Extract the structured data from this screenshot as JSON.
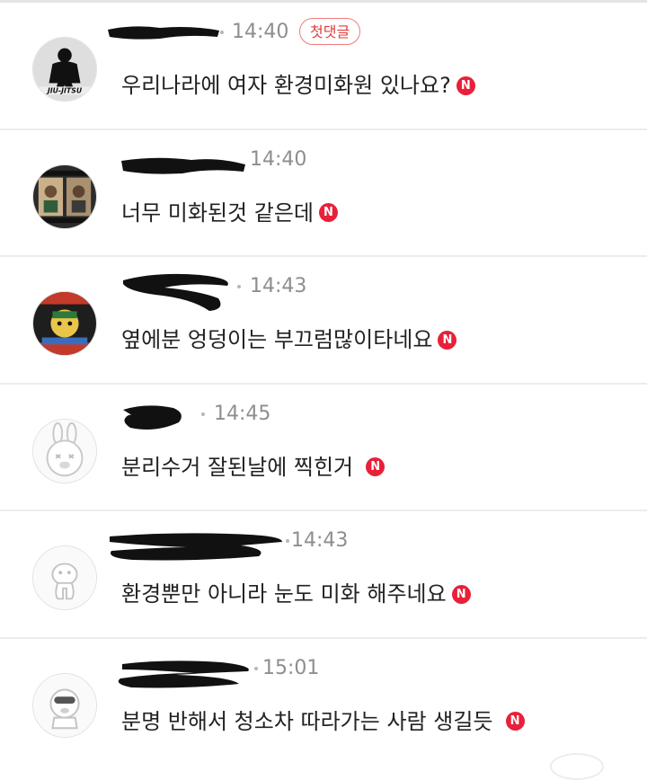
{
  "comments": [
    {
      "time": "14:40",
      "badge": "첫댓글",
      "text": "우리나라에 여자 환경미화원 있나요?",
      "new_badge": "N",
      "avatar": "jiu-jitsu-avatar"
    },
    {
      "time": "14:40",
      "text": "너무 미화된것 같은데",
      "new_badge": "N",
      "avatar": "film-photo-avatar"
    },
    {
      "time": "14:43",
      "text": "옆에분 엉덩이는 부끄럼많이타네요",
      "new_badge": "N",
      "avatar": "cartoon-character-avatar"
    },
    {
      "time": "14:45",
      "text": "분리수거 잘된날에 찍힌거",
      "new_badge": "N",
      "avatar": "bunny-default-avatar"
    },
    {
      "time": "14:43",
      "text": "환경뿐만 아니라 눈도 미화 해주네요",
      "new_badge": "N",
      "avatar": "creature-default-avatar"
    },
    {
      "time": "15:01",
      "text": "분명 반해서 청소차 따라가는 사람 생길듯",
      "new_badge": "N",
      "avatar": "mascot-default-avatar"
    }
  ],
  "colors": {
    "new_badge": "#e8203a",
    "first_badge": "#e33b3b",
    "time": "#8e8e8e",
    "divider": "#ececec"
  }
}
